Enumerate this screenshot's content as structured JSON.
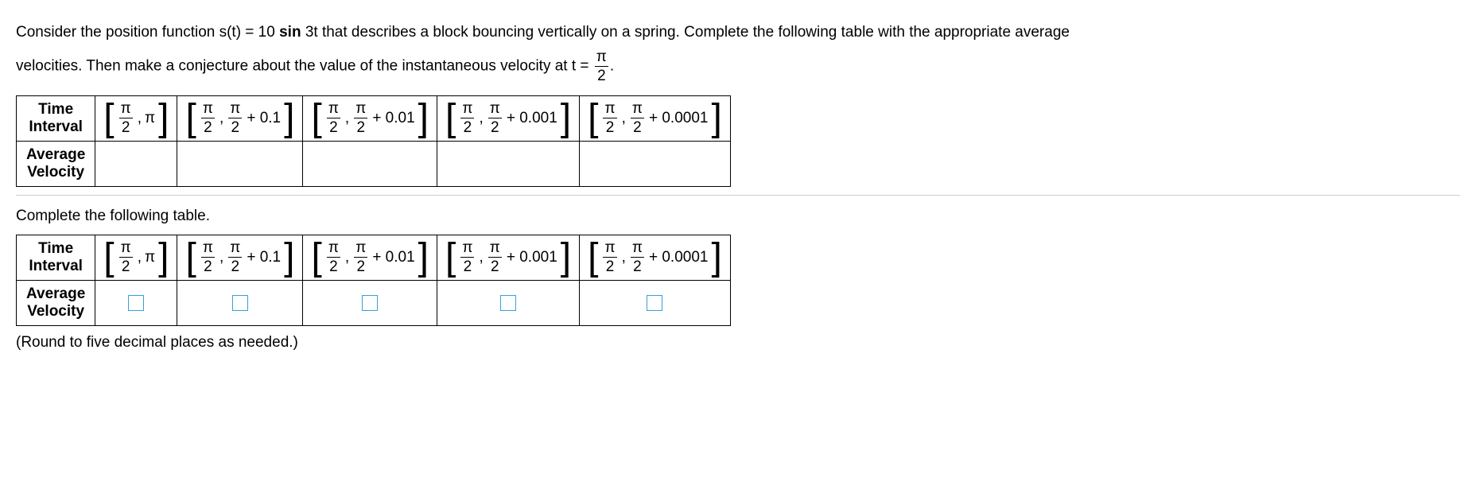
{
  "question": {
    "line1_pre": "Consider the position function s(t) = 10 ",
    "line1_sin": "sin",
    "line1_post": " 3t that describes a block bouncing vertically on a spring. Complete the following table with the appropriate average",
    "line2_pre": "velocities. Then make a conjecture about the value of the instantaneous velocity at t = ",
    "line2_frac_num": "π",
    "line2_frac_den": "2",
    "line2_end": "."
  },
  "row_labels": {
    "time_interval_1": "Time",
    "time_interval_2": "Interval",
    "avg_vel_1": "Average",
    "avg_vel_2": "Velocity"
  },
  "intervals": [
    {
      "a_num": "π",
      "a_den": "2",
      "b_num": "",
      "b_den": "",
      "b_whole": "π",
      "offset": ""
    },
    {
      "a_num": "π",
      "a_den": "2",
      "b_num": "π",
      "b_den": "2",
      "b_whole": "",
      "offset": " + 0.1"
    },
    {
      "a_num": "π",
      "a_den": "2",
      "b_num": "π",
      "b_den": "2",
      "b_whole": "",
      "offset": " + 0.01"
    },
    {
      "a_num": "π",
      "a_den": "2",
      "b_num": "π",
      "b_den": "2",
      "b_whole": "",
      "offset": " + 0.001"
    },
    {
      "a_num": "π",
      "a_den": "2",
      "b_num": "π",
      "b_den": "2",
      "b_whole": "",
      "offset": " + 0.0001"
    }
  ],
  "subhead": "Complete the following table.",
  "round_note": "(Round to five decimal places as needed.)"
}
